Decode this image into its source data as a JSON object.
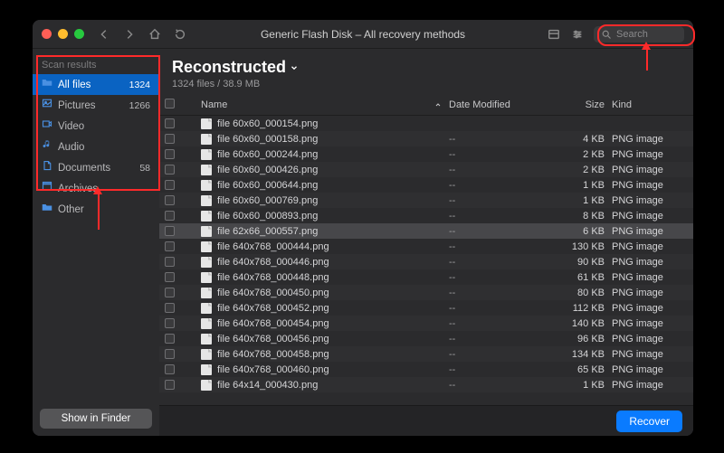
{
  "window": {
    "title": "Generic Flash Disk – All recovery methods"
  },
  "search": {
    "placeholder": "Search"
  },
  "sidebar": {
    "heading": "Scan results",
    "items": [
      {
        "label": "All files",
        "count": "1324",
        "selected": true,
        "icon": "folder"
      },
      {
        "label": "Pictures",
        "count": "1266",
        "selected": false,
        "icon": "picture"
      },
      {
        "label": "Video",
        "count": "",
        "selected": false,
        "icon": "video"
      },
      {
        "label": "Audio",
        "count": "",
        "selected": false,
        "icon": "audio"
      },
      {
        "label": "Documents",
        "count": "58",
        "selected": false,
        "icon": "document"
      },
      {
        "label": "Archives",
        "count": "",
        "selected": false,
        "icon": "archive"
      },
      {
        "label": "Other",
        "count": "",
        "selected": false,
        "icon": "other"
      }
    ],
    "footer_btn": "Show in Finder"
  },
  "main": {
    "title": "Reconstructed",
    "subtitle": "1324 files / 38.9 MB",
    "columns": {
      "name": "Name",
      "date": "Date Modified",
      "size": "Size",
      "kind": "Kind"
    }
  },
  "rows": [
    {
      "name": "file 60x60_000154.png",
      "date": "",
      "size": "",
      "kind": ""
    },
    {
      "name": "file 60x60_000158.png",
      "date": "--",
      "size": "4 KB",
      "kind": "PNG image"
    },
    {
      "name": "file 60x60_000244.png",
      "date": "--",
      "size": "2 KB",
      "kind": "PNG image"
    },
    {
      "name": "file 60x60_000426.png",
      "date": "--",
      "size": "2 KB",
      "kind": "PNG image"
    },
    {
      "name": "file 60x60_000644.png",
      "date": "--",
      "size": "1 KB",
      "kind": "PNG image"
    },
    {
      "name": "file 60x60_000769.png",
      "date": "--",
      "size": "1 KB",
      "kind": "PNG image"
    },
    {
      "name": "file 60x60_000893.png",
      "date": "--",
      "size": "8 KB",
      "kind": "PNG image"
    },
    {
      "name": "file 62x66_000557.png",
      "date": "--",
      "size": "6 KB",
      "kind": "PNG image",
      "sel": true
    },
    {
      "name": "file 640x768_000444.png",
      "date": "--",
      "size": "130 KB",
      "kind": "PNG image"
    },
    {
      "name": "file 640x768_000446.png",
      "date": "--",
      "size": "90 KB",
      "kind": "PNG image"
    },
    {
      "name": "file 640x768_000448.png",
      "date": "--",
      "size": "61 KB",
      "kind": "PNG image"
    },
    {
      "name": "file 640x768_000450.png",
      "date": "--",
      "size": "80 KB",
      "kind": "PNG image"
    },
    {
      "name": "file 640x768_000452.png",
      "date": "--",
      "size": "112 KB",
      "kind": "PNG image"
    },
    {
      "name": "file 640x768_000454.png",
      "date": "--",
      "size": "140 KB",
      "kind": "PNG image"
    },
    {
      "name": "file 640x768_000456.png",
      "date": "--",
      "size": "96 KB",
      "kind": "PNG image"
    },
    {
      "name": "file 640x768_000458.png",
      "date": "--",
      "size": "134 KB",
      "kind": "PNG image"
    },
    {
      "name": "file 640x768_000460.png",
      "date": "--",
      "size": "65 KB",
      "kind": "PNG image"
    },
    {
      "name": "file 64x14_000430.png",
      "date": "--",
      "size": "1 KB",
      "kind": "PNG image"
    }
  ],
  "footer": {
    "recover": "Recover"
  }
}
